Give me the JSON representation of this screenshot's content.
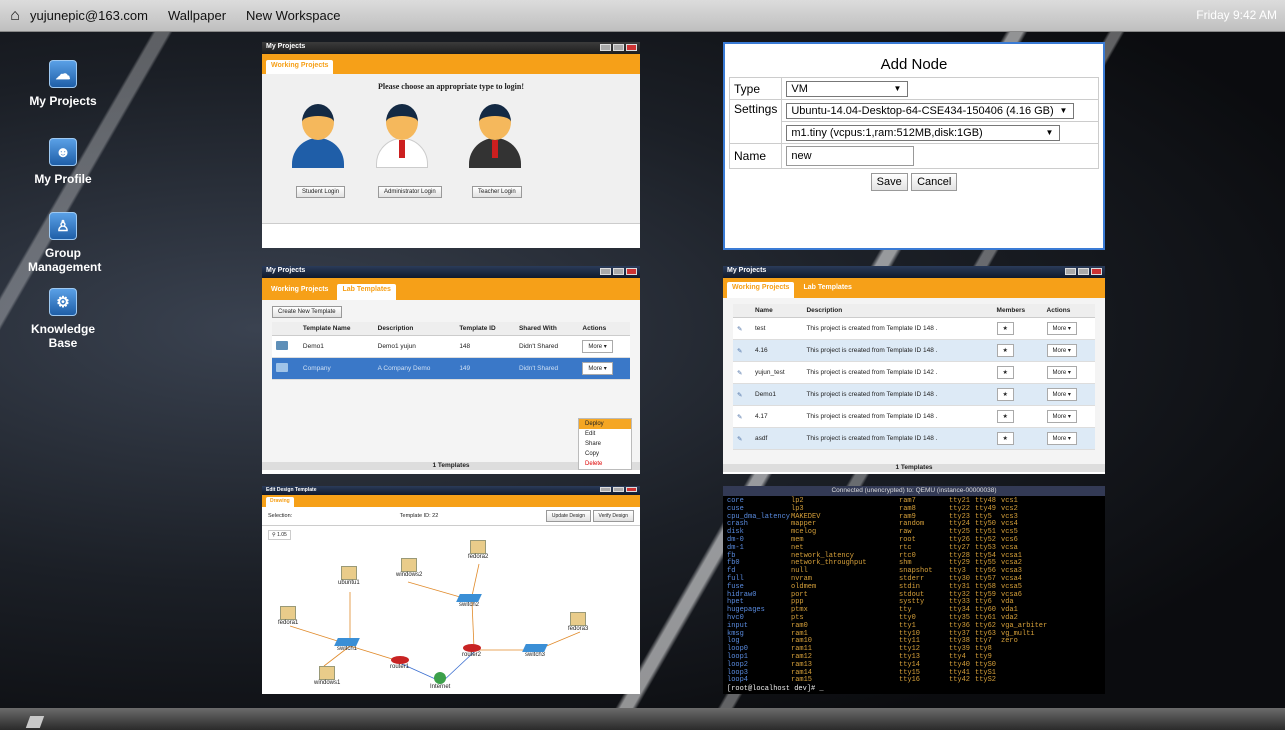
{
  "topbar": {
    "user": "yujunepic@163.com",
    "menu": [
      "Wallpaper",
      "New Workspace"
    ],
    "clock": "Friday 9:42 AM"
  },
  "desktop_icons": [
    {
      "label": "My Projects",
      "icon": "cloud-icon"
    },
    {
      "label": "My Profile",
      "icon": "person-icon"
    },
    {
      "label": "Group Management",
      "icon": "group-icon"
    },
    {
      "label": "Knowledge Base",
      "icon": "gear-icon"
    }
  ],
  "login_window": {
    "title": "My Projects",
    "tab": "Working Projects",
    "prompt": "Please choose an appropriate type to login!",
    "buttons": [
      "Student Login",
      "Administrator Login",
      "Teacher Login"
    ]
  },
  "add_node": {
    "title": "Add Node",
    "type_label": "Type",
    "type_value": "VM",
    "settings_label": "Settings",
    "image_value": "Ubuntu-14.04-Desktop-64-CSE434-150406 (4.16 GB)",
    "flavor_value": "m1.tiny (vcpus:1,ram:512MB,disk:1GB)",
    "name_label": "Name",
    "name_value": "new",
    "save": "Save",
    "cancel": "Cancel"
  },
  "templates_window": {
    "title": "My Projects",
    "tabs": [
      "Working Projects",
      "Lab Templates"
    ],
    "create_btn": "Create New Template",
    "columns": [
      "Template Name",
      "Description",
      "Template ID",
      "Shared With",
      "Actions"
    ],
    "rows": [
      [
        "Demo1",
        "Demo1 yujun",
        "148",
        "Didn't Shared",
        "More"
      ],
      [
        "Company",
        "A Company Demo",
        "149",
        "Didn't Shared",
        "More"
      ]
    ],
    "menu": [
      "Deploy",
      "Edit",
      "Share",
      "Copy",
      "Delete"
    ],
    "footer": "1 Templates"
  },
  "projects_window": {
    "title": "My Projects",
    "tabs": [
      "Working Projects",
      "Lab Templates"
    ],
    "columns": [
      "Name",
      "Description",
      "Members",
      "Actions"
    ],
    "rows": [
      [
        "test",
        "This project is created from Template ID 148 ."
      ],
      [
        "4.16",
        "This project is created from Template ID 148 ."
      ],
      [
        "yujun_test",
        "This project is created from Template ID 142 ."
      ],
      [
        "Demo1",
        "This project is created from Template ID 148 ."
      ],
      [
        "4.17",
        "This project is created from Template ID 148 ."
      ],
      [
        "asdf",
        "This project is created from Template ID 148 ."
      ]
    ],
    "more": "More",
    "footer": "1 Templates"
  },
  "design_window": {
    "title": "Edit Design Template",
    "tab": "Drawing",
    "selection": "Selection:",
    "template_id": "Template ID: 22",
    "update": "Update Design",
    "verify": "Verify Design",
    "zoom": "1.05",
    "nodes": [
      "ubuntu1",
      "windows2",
      "fedora2",
      "fedora1",
      "switch2",
      "switch1",
      "router1",
      "router2",
      "switch3",
      "fedora3",
      "Internet",
      "windows1"
    ]
  },
  "terminal": {
    "title": "Connected (unencrypted) to: QEMU (instance-00000038)",
    "col1": [
      "core",
      "cuse",
      "cpu_dma_latency",
      "crash",
      "disk",
      "dm-0",
      "dm-1",
      "fb",
      "fb0",
      "fd",
      "full",
      "fuse",
      "hidraw0",
      "hpet",
      "hugepages",
      "hvc0",
      "input",
      "kmsg",
      "log",
      "loop0",
      "loop1",
      "loop2",
      "loop3",
      "loop4"
    ],
    "col2": [
      "lp2",
      "lp3",
      "MAKEDEV",
      "mapper",
      "mcelog",
      "mem",
      "net",
      "network_latency",
      "network_throughput",
      "null",
      "nvram",
      "oldmem",
      "port",
      "ppp",
      "ptmx",
      "pts",
      "ram0",
      "ram1",
      "ram10",
      "ram11",
      "ram12",
      "ram13",
      "ram14",
      "ram15"
    ],
    "col3": [
      "ram7",
      "ram8",
      "ram9",
      "random",
      "raw",
      "root",
      "rtc",
      "rtc0",
      "shm",
      "snapshot",
      "stderr",
      "stdin",
      "stdout",
      "systty",
      "tty",
      "tty0",
      "tty1",
      "tty10",
      "tty11",
      "tty12",
      "tty13",
      "tty14",
      "tty15",
      "tty16"
    ],
    "col4": [
      "tty21",
      "tty22",
      "tty23",
      "tty24",
      "tty25",
      "tty26",
      "tty27",
      "tty28",
      "tty29",
      "tty3",
      "tty30",
      "tty31",
      "tty32",
      "tty33",
      "tty34",
      "tty35",
      "tty36",
      "tty37",
      "tty38",
      "tty39",
      "tty4",
      "tty40",
      "tty41",
      "tty42"
    ],
    "col5": [
      "tty48",
      "tty49",
      "tty5",
      "tty50",
      "tty51",
      "tty52",
      "tty53",
      "tty54",
      "tty55",
      "tty56",
      "tty57",
      "tty58",
      "tty59",
      "tty6",
      "tty60",
      "tty61",
      "tty62",
      "tty63",
      "tty7",
      "tty8",
      "tty9",
      "ttyS0",
      "ttyS1",
      "ttyS2"
    ],
    "col6": [
      "vcs1",
      "vcs2",
      "vcs3",
      "vcs4",
      "vcs5",
      "vcs6",
      "vcsa",
      "vcsa1",
      "vcsa2",
      "vcsa3",
      "vcsa4",
      "vcsa5",
      "vcsa6",
      "vda",
      "vda1",
      "vda2",
      "vga_arbiter",
      "vg_multi",
      "zero"
    ],
    "prompt": "[root@localhost dev]# _"
  }
}
